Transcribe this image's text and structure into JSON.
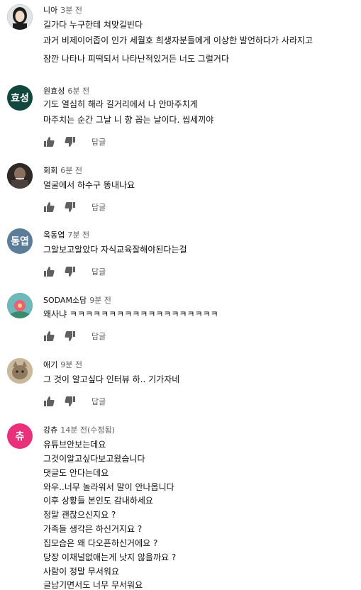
{
  "comments": [
    {
      "author": "니아",
      "time": "3분 전",
      "avatar": {
        "kind": "photo",
        "color": "#2b2b2b"
      },
      "lines": [
        "길가다 누구한테 쳐맞길빈다",
        "과거 비제이어좁이 인가 세월호 희생자분들에게 이상한 발언하다가 사라지고",
        "잠깐 나타나 피떡되서 나타난적있거든 너도 그럴거다"
      ]
    },
    {
      "author": "원효성",
      "time": "6분 전",
      "avatar": {
        "kind": "letters",
        "letters": "효성",
        "color": "#12473d"
      },
      "lines": [
        "기도 열심히 해라 길거리에서 나 안마주치게",
        "마주치는 순간 그날 니 향 꼽는 날이다. 씹세끼야"
      ],
      "reply_label": "답글"
    },
    {
      "author": "회회",
      "time": "6분 전",
      "avatar": {
        "kind": "photo",
        "color": "#3a3330"
      },
      "lines": [
        "얼굴에서 하수구 똥내나요"
      ],
      "reply_label": "답글"
    },
    {
      "author": "옥동엽",
      "time": "7분 전",
      "avatar": {
        "kind": "letters",
        "letters": "동엽",
        "color": "#5c7d99"
      },
      "lines": [
        "그알보고알았다 자식교육잘해야된다는걸"
      ],
      "reply_label": "답글"
    },
    {
      "author": "SODAM소담",
      "time": "9분 전",
      "avatar": {
        "kind": "photo",
        "color": "#3f8f95"
      },
      "lines": [
        "왜사냐 ㅋㅋㅋㅋㅋㅋㅋㅋㅋㅋㅋㅋㅋㅋㅋㅋㅋㅋㅋ"
      ],
      "reply_label": "답글"
    },
    {
      "author": "애기",
      "time": "9분 전",
      "avatar": {
        "kind": "photo",
        "color": "#a8957a"
      },
      "lines": [
        "그 것이 알고싶다 인터뷰 하..  기가자네"
      ],
      "reply_label": "답글"
    },
    {
      "author": "강츄",
      "time": "14분 전(수정됨)",
      "avatar": {
        "kind": "letters",
        "letters": "츄",
        "color": "#e8317a"
      },
      "lines": [
        "유튜브안보는데요",
        "그것이알고싶다보고왔습니다",
        "댓글도 안다는데요",
        "와우..너무 놀라워서 말이 안나옵니다",
        "이후 상황들 본인도 감내하세요",
        "정말 괜찮으신지요 ?",
        "가족들 생각은 하신거지요 ?",
        "집모습은 왜 다오픈하신거에요 ?",
        "당장 이채널없애는게 낫지 않을까요 ?",
        "사람이 정말 무서워요",
        "글남기면서도 너무 무서워요"
      ]
    }
  ]
}
